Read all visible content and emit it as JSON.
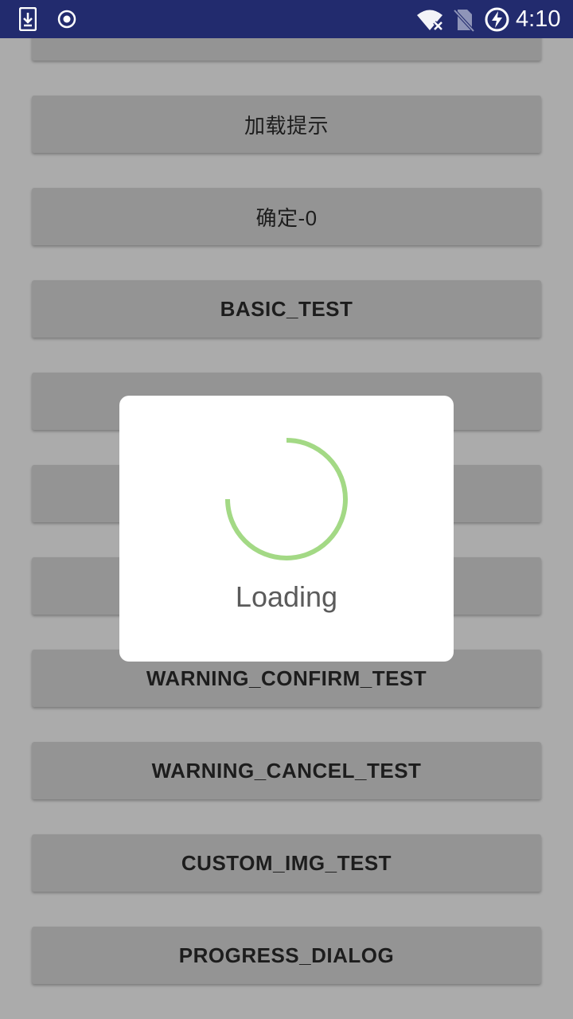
{
  "status_bar": {
    "time": "4:10",
    "icons": [
      "download-icon",
      "record-icon",
      "wifi-off-icon",
      "no-sim-icon",
      "battery-charging-icon"
    ],
    "bg_color": "#222b6e"
  },
  "buttons": {
    "b0": "",
    "b1": "加载提示",
    "b2": "确定-0",
    "b3": "BASIC_TEST",
    "b4": "",
    "b5": "",
    "b6": "",
    "b7": "WARNING_CONFIRM_TEST",
    "b8": "WARNING_CANCEL_TEST",
    "b9": "CUSTOM_IMG_TEST",
    "b10": "PROGRESS_DIALOG"
  },
  "dialog": {
    "text": "Loading",
    "spinner_color": "#a3d985"
  }
}
